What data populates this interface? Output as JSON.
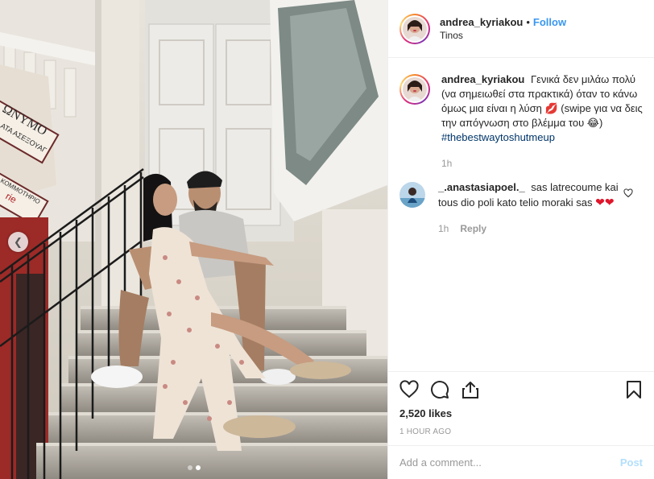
{
  "header": {
    "username": "andrea_kyriakou",
    "separator": "•",
    "follow_label": "Follow",
    "location": "Tinos"
  },
  "photo": {
    "sign_text_1": "ΩΝΥΜΟ",
    "sign_text_2": "ΑΤΑ ΑΣΕΞΟΥΑΓ",
    "sign_text_3": "ΚΟΜΜΟΤΗΡΙΟ",
    "sign_text_4": "rie",
    "prev_icon": "chevron-left-icon",
    "carousel_total": 2,
    "carousel_active": 2
  },
  "caption": {
    "username": "andrea_kyriakou",
    "text": "Γενικά δεν μιλάω πολύ (να σημειωθεί στα πρακτικά) όταν το κάνω όμως μια είναι η λύση 💋 (swipe για να δεις την απόγνωση στο βλέμμα του 😂)",
    "hashtag": "#thebestwaytoshutmeup",
    "time": "1h"
  },
  "comment": {
    "username": "_.anastasiapoel._",
    "text": "sas latrecoume kai tous dio poli kato telio moraki sas",
    "hearts": "❤❤",
    "time": "1h",
    "reply_label": "Reply"
  },
  "actions": {
    "icons": [
      "heart-icon",
      "comment-icon",
      "share-icon",
      "bookmark-icon"
    ],
    "likes": "2,520 likes",
    "timestamp": "1 HOUR AGO"
  },
  "composer": {
    "placeholder": "Add a comment...",
    "post_label": "Post"
  },
  "colors": {
    "link": "#3897f0",
    "hashtag": "#003569",
    "muted": "#999999",
    "post_disabled": "#b2dffc",
    "heart_red": "#e0162b"
  }
}
